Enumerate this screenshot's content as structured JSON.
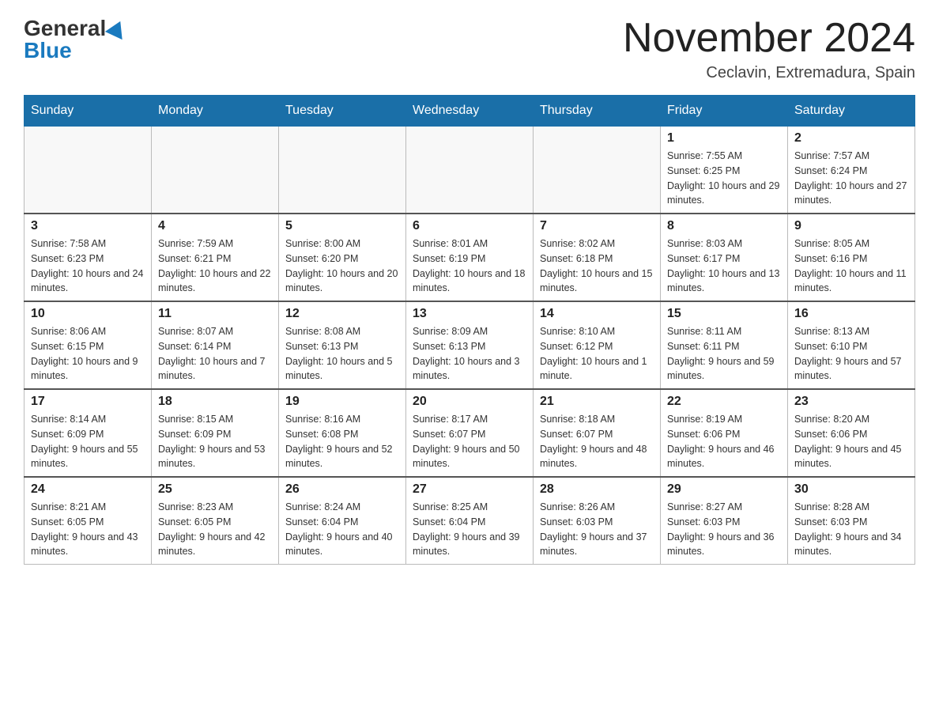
{
  "header": {
    "logo_general": "General",
    "logo_blue": "Blue",
    "month_title": "November 2024",
    "location": "Ceclavin, Extremadura, Spain"
  },
  "days_of_week": [
    "Sunday",
    "Monday",
    "Tuesday",
    "Wednesday",
    "Thursday",
    "Friday",
    "Saturday"
  ],
  "weeks": [
    [
      {
        "day": "",
        "sunrise": "",
        "sunset": "",
        "daylight": "",
        "empty": true
      },
      {
        "day": "",
        "sunrise": "",
        "sunset": "",
        "daylight": "",
        "empty": true
      },
      {
        "day": "",
        "sunrise": "",
        "sunset": "",
        "daylight": "",
        "empty": true
      },
      {
        "day": "",
        "sunrise": "",
        "sunset": "",
        "daylight": "",
        "empty": true
      },
      {
        "day": "",
        "sunrise": "",
        "sunset": "",
        "daylight": "",
        "empty": true
      },
      {
        "day": "1",
        "sunrise": "Sunrise: 7:55 AM",
        "sunset": "Sunset: 6:25 PM",
        "daylight": "Daylight: 10 hours and 29 minutes.",
        "empty": false
      },
      {
        "day": "2",
        "sunrise": "Sunrise: 7:57 AM",
        "sunset": "Sunset: 6:24 PM",
        "daylight": "Daylight: 10 hours and 27 minutes.",
        "empty": false
      }
    ],
    [
      {
        "day": "3",
        "sunrise": "Sunrise: 7:58 AM",
        "sunset": "Sunset: 6:23 PM",
        "daylight": "Daylight: 10 hours and 24 minutes.",
        "empty": false
      },
      {
        "day": "4",
        "sunrise": "Sunrise: 7:59 AM",
        "sunset": "Sunset: 6:21 PM",
        "daylight": "Daylight: 10 hours and 22 minutes.",
        "empty": false
      },
      {
        "day": "5",
        "sunrise": "Sunrise: 8:00 AM",
        "sunset": "Sunset: 6:20 PM",
        "daylight": "Daylight: 10 hours and 20 minutes.",
        "empty": false
      },
      {
        "day": "6",
        "sunrise": "Sunrise: 8:01 AM",
        "sunset": "Sunset: 6:19 PM",
        "daylight": "Daylight: 10 hours and 18 minutes.",
        "empty": false
      },
      {
        "day": "7",
        "sunrise": "Sunrise: 8:02 AM",
        "sunset": "Sunset: 6:18 PM",
        "daylight": "Daylight: 10 hours and 15 minutes.",
        "empty": false
      },
      {
        "day": "8",
        "sunrise": "Sunrise: 8:03 AM",
        "sunset": "Sunset: 6:17 PM",
        "daylight": "Daylight: 10 hours and 13 minutes.",
        "empty": false
      },
      {
        "day": "9",
        "sunrise": "Sunrise: 8:05 AM",
        "sunset": "Sunset: 6:16 PM",
        "daylight": "Daylight: 10 hours and 11 minutes.",
        "empty": false
      }
    ],
    [
      {
        "day": "10",
        "sunrise": "Sunrise: 8:06 AM",
        "sunset": "Sunset: 6:15 PM",
        "daylight": "Daylight: 10 hours and 9 minutes.",
        "empty": false
      },
      {
        "day": "11",
        "sunrise": "Sunrise: 8:07 AM",
        "sunset": "Sunset: 6:14 PM",
        "daylight": "Daylight: 10 hours and 7 minutes.",
        "empty": false
      },
      {
        "day": "12",
        "sunrise": "Sunrise: 8:08 AM",
        "sunset": "Sunset: 6:13 PM",
        "daylight": "Daylight: 10 hours and 5 minutes.",
        "empty": false
      },
      {
        "day": "13",
        "sunrise": "Sunrise: 8:09 AM",
        "sunset": "Sunset: 6:13 PM",
        "daylight": "Daylight: 10 hours and 3 minutes.",
        "empty": false
      },
      {
        "day": "14",
        "sunrise": "Sunrise: 8:10 AM",
        "sunset": "Sunset: 6:12 PM",
        "daylight": "Daylight: 10 hours and 1 minute.",
        "empty": false
      },
      {
        "day": "15",
        "sunrise": "Sunrise: 8:11 AM",
        "sunset": "Sunset: 6:11 PM",
        "daylight": "Daylight: 9 hours and 59 minutes.",
        "empty": false
      },
      {
        "day": "16",
        "sunrise": "Sunrise: 8:13 AM",
        "sunset": "Sunset: 6:10 PM",
        "daylight": "Daylight: 9 hours and 57 minutes.",
        "empty": false
      }
    ],
    [
      {
        "day": "17",
        "sunrise": "Sunrise: 8:14 AM",
        "sunset": "Sunset: 6:09 PM",
        "daylight": "Daylight: 9 hours and 55 minutes.",
        "empty": false
      },
      {
        "day": "18",
        "sunrise": "Sunrise: 8:15 AM",
        "sunset": "Sunset: 6:09 PM",
        "daylight": "Daylight: 9 hours and 53 minutes.",
        "empty": false
      },
      {
        "day": "19",
        "sunrise": "Sunrise: 8:16 AM",
        "sunset": "Sunset: 6:08 PM",
        "daylight": "Daylight: 9 hours and 52 minutes.",
        "empty": false
      },
      {
        "day": "20",
        "sunrise": "Sunrise: 8:17 AM",
        "sunset": "Sunset: 6:07 PM",
        "daylight": "Daylight: 9 hours and 50 minutes.",
        "empty": false
      },
      {
        "day": "21",
        "sunrise": "Sunrise: 8:18 AM",
        "sunset": "Sunset: 6:07 PM",
        "daylight": "Daylight: 9 hours and 48 minutes.",
        "empty": false
      },
      {
        "day": "22",
        "sunrise": "Sunrise: 8:19 AM",
        "sunset": "Sunset: 6:06 PM",
        "daylight": "Daylight: 9 hours and 46 minutes.",
        "empty": false
      },
      {
        "day": "23",
        "sunrise": "Sunrise: 8:20 AM",
        "sunset": "Sunset: 6:06 PM",
        "daylight": "Daylight: 9 hours and 45 minutes.",
        "empty": false
      }
    ],
    [
      {
        "day": "24",
        "sunrise": "Sunrise: 8:21 AM",
        "sunset": "Sunset: 6:05 PM",
        "daylight": "Daylight: 9 hours and 43 minutes.",
        "empty": false
      },
      {
        "day": "25",
        "sunrise": "Sunrise: 8:23 AM",
        "sunset": "Sunset: 6:05 PM",
        "daylight": "Daylight: 9 hours and 42 minutes.",
        "empty": false
      },
      {
        "day": "26",
        "sunrise": "Sunrise: 8:24 AM",
        "sunset": "Sunset: 6:04 PM",
        "daylight": "Daylight: 9 hours and 40 minutes.",
        "empty": false
      },
      {
        "day": "27",
        "sunrise": "Sunrise: 8:25 AM",
        "sunset": "Sunset: 6:04 PM",
        "daylight": "Daylight: 9 hours and 39 minutes.",
        "empty": false
      },
      {
        "day": "28",
        "sunrise": "Sunrise: 8:26 AM",
        "sunset": "Sunset: 6:03 PM",
        "daylight": "Daylight: 9 hours and 37 minutes.",
        "empty": false
      },
      {
        "day": "29",
        "sunrise": "Sunrise: 8:27 AM",
        "sunset": "Sunset: 6:03 PM",
        "daylight": "Daylight: 9 hours and 36 minutes.",
        "empty": false
      },
      {
        "day": "30",
        "sunrise": "Sunrise: 8:28 AM",
        "sunset": "Sunset: 6:03 PM",
        "daylight": "Daylight: 9 hours and 34 minutes.",
        "empty": false
      }
    ]
  ]
}
